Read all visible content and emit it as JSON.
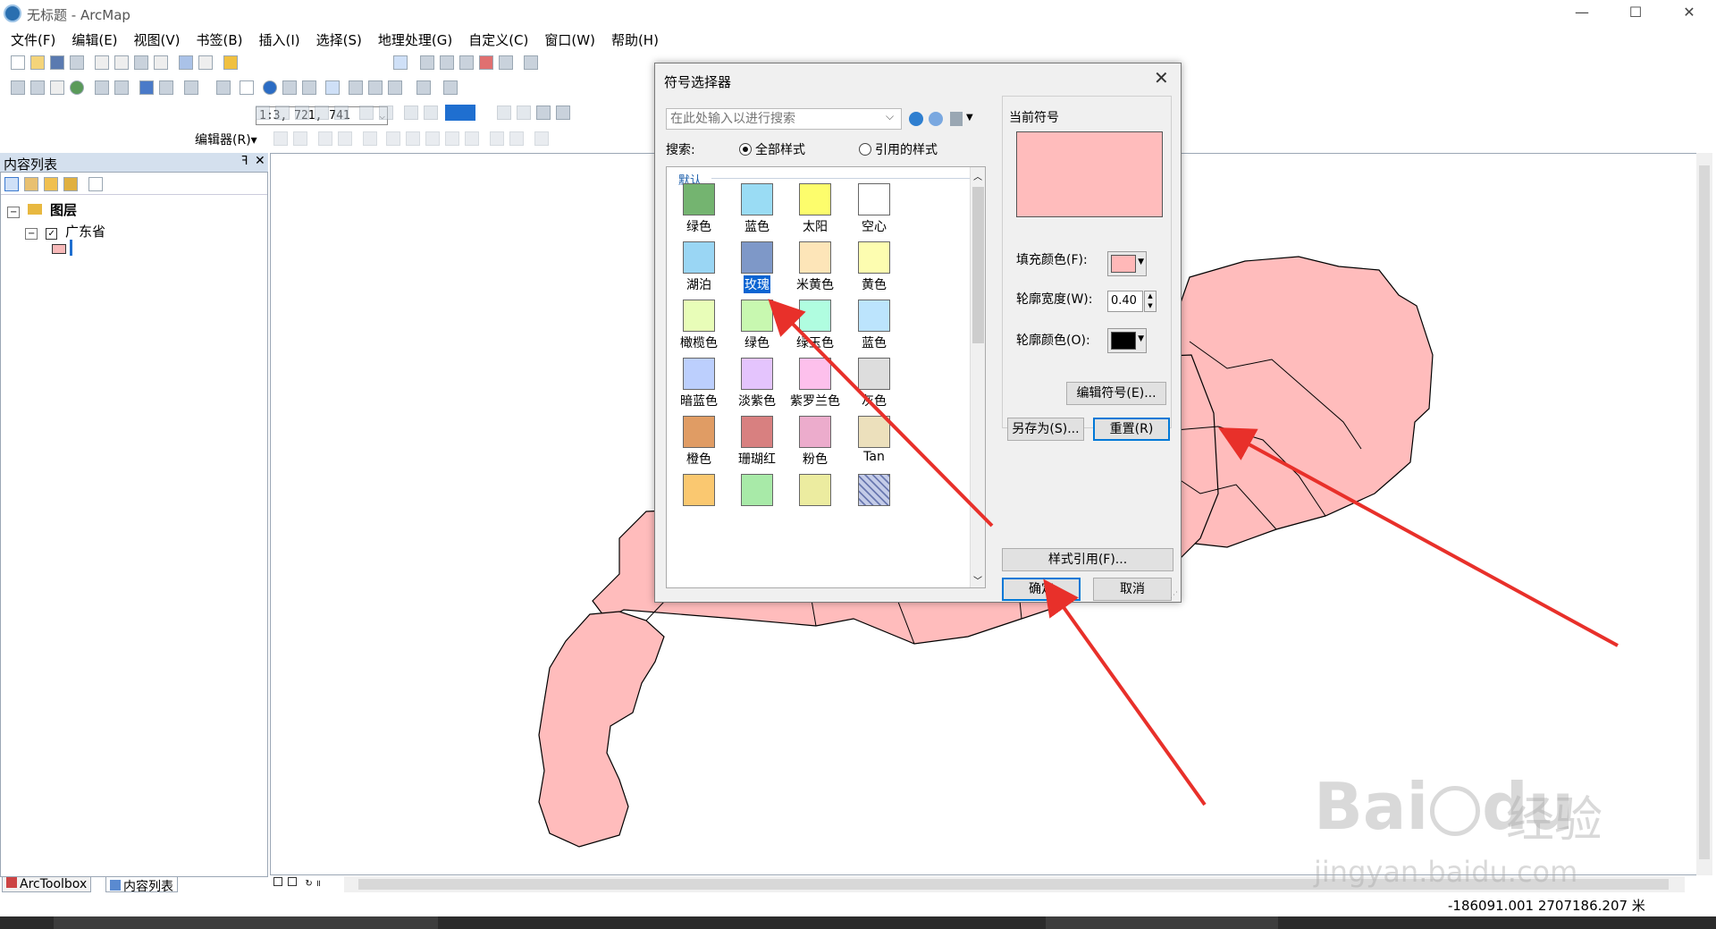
{
  "window": {
    "title": "无标题 - ArcMap",
    "minimize": "—",
    "maximize": "☐",
    "close": "✕"
  },
  "menus": [
    "文件(F)",
    "编辑(E)",
    "视图(V)",
    "书签(B)",
    "插入(I)",
    "选择(S)",
    "地理处理(G)",
    "自定义(C)",
    "窗口(W)",
    "帮助(H)"
  ],
  "toolbar": {
    "scale": "1:3, 721, 741",
    "editor_label": "编辑器(R)▾"
  },
  "toc": {
    "title": "内容列表",
    "pin": "ꟻ",
    "close": "✕",
    "layers_root": "图层",
    "layer_name": "广东省",
    "layer_fill_color": "#f8b9b9"
  },
  "bottom_tabs": [
    "ArcToolbox",
    "内容列表"
  ],
  "status": {
    "coords": "-186091.001  2707186.207 米"
  },
  "dialog": {
    "title": "符号选择器",
    "close": "✕",
    "search_placeholder": "在此处输入以进行搜索",
    "search_label": "搜索:",
    "radio_all": "全部样式",
    "radio_ref": "引用的样式",
    "group_label": "默认",
    "swatches": [
      {
        "label": "绿色",
        "color": "#74b470"
      },
      {
        "label": "蓝色",
        "color": "#9adcf4"
      },
      {
        "label": "太阳",
        "color": "#fdfd6c"
      },
      {
        "label": "空心",
        "color": "#ffffff"
      },
      {
        "label": "湖泊",
        "color": "#9ad6f4"
      },
      {
        "label": "玫瑰",
        "color": "#7e98c8"
      },
      {
        "label": "米黄色",
        "color": "#fde5b8"
      },
      {
        "label": "黄色",
        "color": "#fdfdb0"
      },
      {
        "label": "橄榄色",
        "color": "#e8fdb8"
      },
      {
        "label": "绿色",
        "color": "#c8f8b0"
      },
      {
        "label": "绿玉色",
        "color": "#b0fde0"
      },
      {
        "label": "蓝色",
        "color": "#bce4fd"
      },
      {
        "label": "暗蓝色",
        "color": "#bccffd"
      },
      {
        "label": "淡紫色",
        "color": "#e4c4fd"
      },
      {
        "label": "紫罗兰色",
        "color": "#fdc0ec"
      },
      {
        "label": "灰色",
        "color": "#dddddd"
      },
      {
        "label": "橙色",
        "color": "#e09c64"
      },
      {
        "label": "珊瑚红",
        "color": "#d88080"
      },
      {
        "label": "粉色",
        "color": "#ecaccc"
      },
      {
        "label": "Tan",
        "color": "#ece0bc"
      },
      {
        "label": "",
        "color": "#fac870"
      },
      {
        "label": "",
        "color": "#a8eaa8"
      },
      {
        "label": "",
        "color": "#ececa0"
      },
      {
        "label": "",
        "color": "#c4cce8"
      }
    ],
    "current_symbol_label": "当前符号",
    "current_color": "#ffbcbc",
    "fill_color_label": "填充颜色(F):",
    "fill_color": "#ffb8b8",
    "outline_width_label": "轮廓宽度(W):",
    "outline_width": "0.40",
    "outline_color_label": "轮廓颜色(O):",
    "outline_color": "#000000",
    "edit_symbol_btn": "编辑符号(E)...",
    "save_as_btn": "另存为(S)...",
    "reset_btn": "重置(R)",
    "style_ref_btn": "样式引用(F)...",
    "ok_btn": "确定",
    "cancel_btn": "取消"
  },
  "map": {
    "region_color": "#ffbcbc",
    "outline_color": "#000000"
  },
  "watermark": {
    "brand": "Bai",
    "brand_tail": "du",
    "brand_cn": "经验",
    "url": "jingyan.baidu.com"
  }
}
